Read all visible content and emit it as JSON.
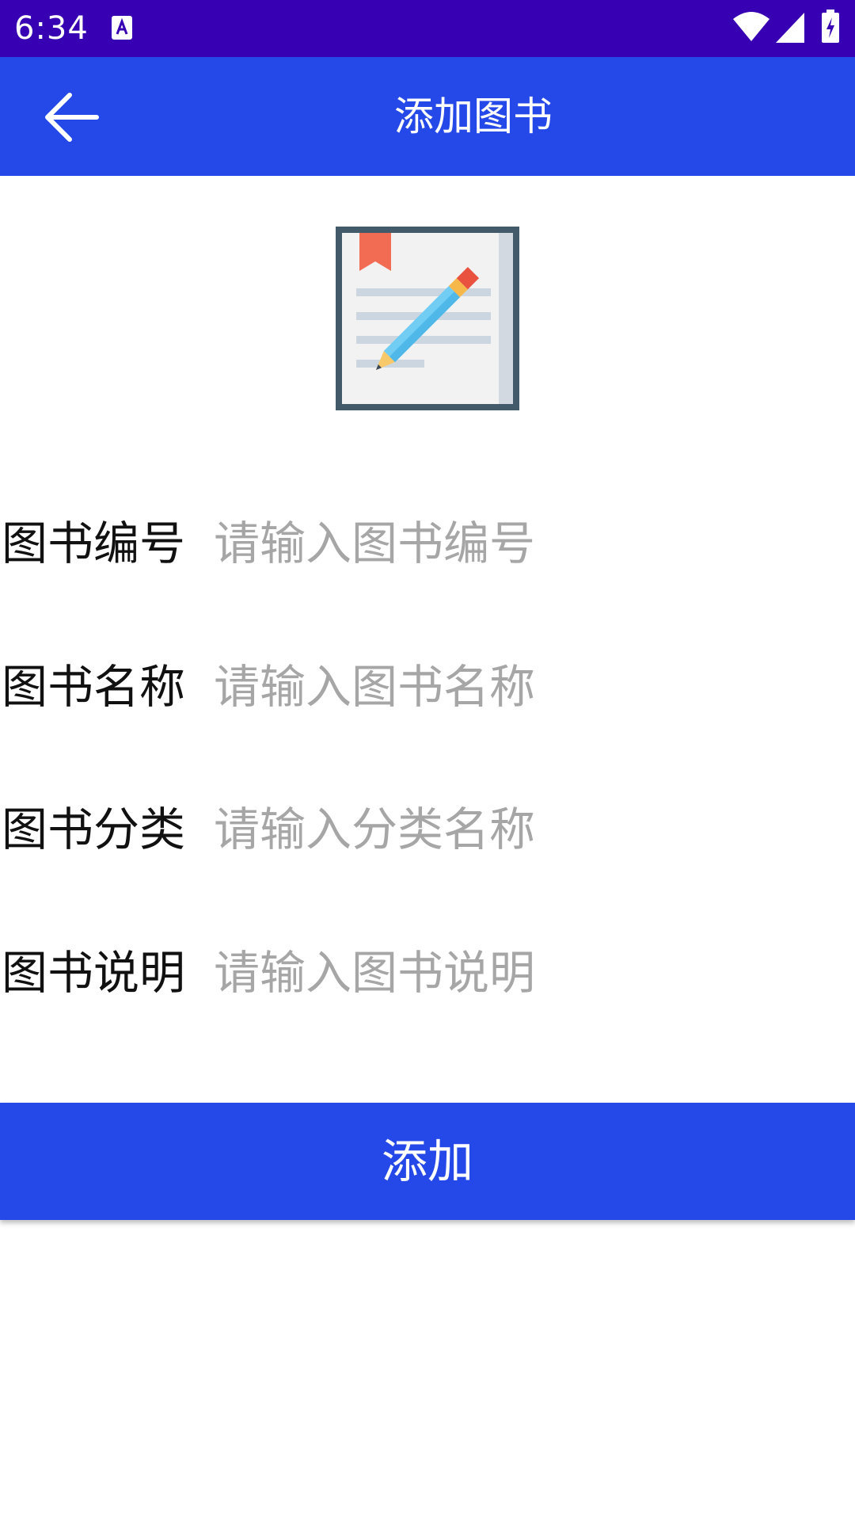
{
  "status_bar": {
    "time": "6:34",
    "notification_icon": "a-notification-icon",
    "wifi_icon": "wifi-icon",
    "signal_icon": "signal-icon",
    "battery_icon": "battery-charging-icon"
  },
  "app_bar": {
    "title": "添加图书",
    "back_icon": "arrow-back-icon"
  },
  "illustration": {
    "icon": "book-edit-icon"
  },
  "form": {
    "fields": [
      {
        "label": "图书编号",
        "placeholder": "请输入图书编号",
        "value": ""
      },
      {
        "label": "图书名称",
        "placeholder": "请输入图书名称",
        "value": ""
      },
      {
        "label": "图书分类",
        "placeholder": "请输入分类名称",
        "value": ""
      },
      {
        "label": "图书说明",
        "placeholder": "请输入图书说明",
        "value": ""
      }
    ]
  },
  "submit": {
    "label": "添加"
  },
  "colors": {
    "status_bar": "#3700b3",
    "primary": "#2548e8",
    "placeholder": "#a6a6a6"
  }
}
